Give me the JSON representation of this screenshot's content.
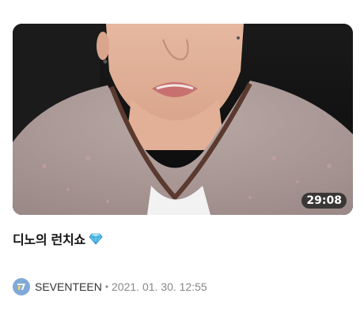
{
  "video": {
    "duration": "29:08",
    "title": "디노의 런치쇼",
    "title_emoji_icon": "diamond-gem-icon"
  },
  "channel": {
    "name": "SEVENTEEN",
    "avatar_icon": "seventeen-logo-icon",
    "separator": "•",
    "date": "2021. 01. 30. 12:55"
  },
  "colors": {
    "background": "#ffffff",
    "duration_badge": "#282828",
    "avatar": "#7fa9d8",
    "gem": "#5fc6f0"
  }
}
